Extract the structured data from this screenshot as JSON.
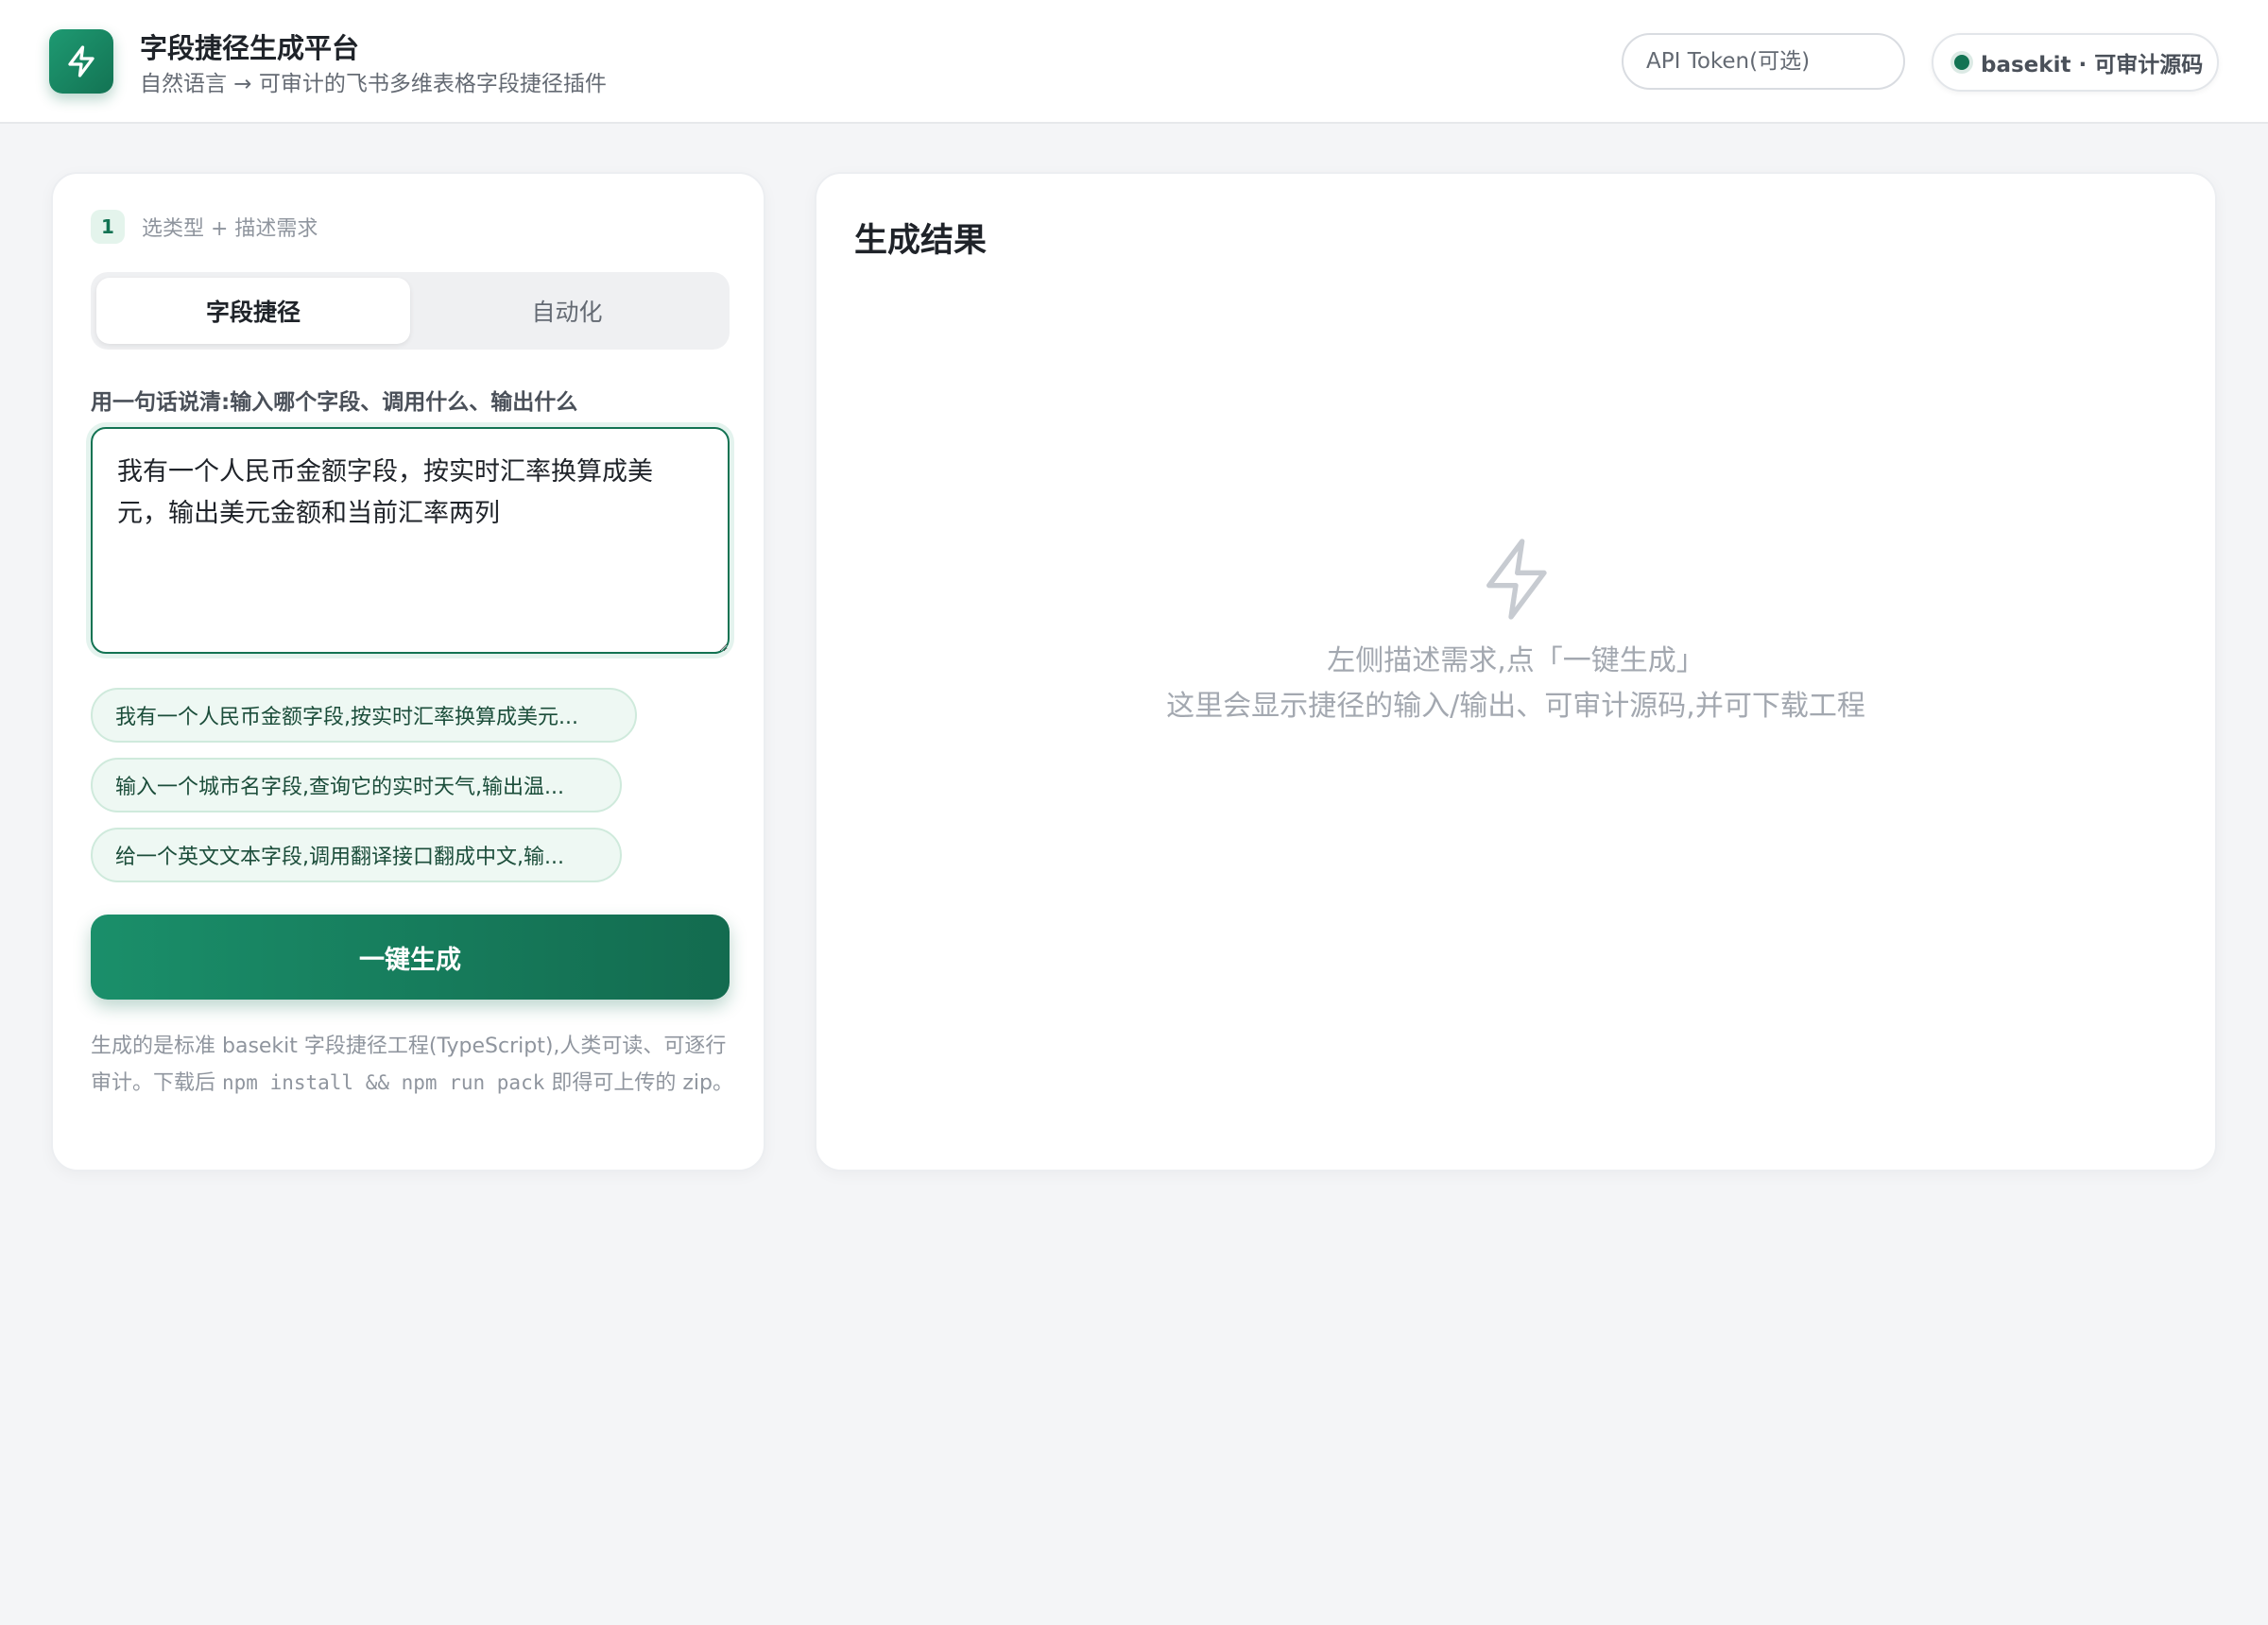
{
  "header": {
    "logo_icon": "lightning-icon",
    "title": "字段捷径生成平台",
    "subtitle": "自然语言 → 可审计的飞书多维表格字段捷径插件",
    "token_placeholder": "API Token(可选)",
    "badge_label": "basekit · 可审计源码"
  },
  "left_panel": {
    "step_number": "1",
    "step_label": "选类型 + 描述需求",
    "tabs": [
      {
        "label": "字段捷径",
        "active": true
      },
      {
        "label": "自动化",
        "active": false
      }
    ],
    "description_label": "用一句话说清:输入哪个字段、调用什么、输出什么",
    "description_value": "我有一个人民币金额字段，按实时汇率换算成美元，输出美元金额和当前汇率两列",
    "examples": [
      "我有一个人民币金额字段,按实时汇率换算成美元...",
      "输入一个城市名字段,查询它的实时天气,输出温...",
      "给一个英文文本字段,调用翻译接口翻成中文,输..."
    ],
    "generate_button": "一键生成",
    "footnote_part1": "生成的是标准 basekit 字段捷径工程(TypeScript),人类可读、可逐行审计。下载后 ",
    "footnote_code": "npm install && npm run pack",
    "footnote_part2": " 即得可上传的 zip。"
  },
  "right_panel": {
    "title": "生成结果",
    "empty_icon": "lightning-outline-icon",
    "empty_line1": "左侧描述需求,点「一键生成」",
    "empty_line2": "这里会显示捷径的输入/输出、可审计源码,并可下载工程"
  },
  "colors": {
    "brand": "#137353",
    "brand_light": "#1e9a72",
    "chip_bg": "#eef8f3",
    "page_bg": "#f4f5f7"
  }
}
